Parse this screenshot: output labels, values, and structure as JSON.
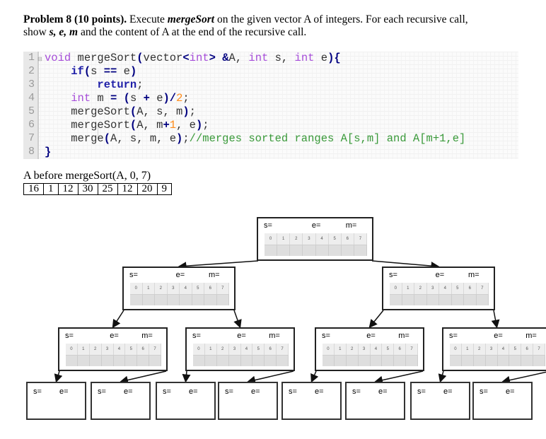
{
  "problem": {
    "heading": "Problem 8 (10 points).",
    "text1": " Execute ",
    "func": "mergeSort",
    "text2": " on the given vector A of integers. For each recursive call,",
    "line2_pre": "show ",
    "vars": "s, e, m",
    "line2_post": " and the content of A at the end of the recursive call."
  },
  "code": {
    "line_numbers": [
      "1",
      "2",
      "3",
      "4",
      "5",
      "6",
      "7",
      "8"
    ],
    "lines": [
      "void mergeSort(vector<int> &A, int s, int e){",
      "    if(s == e)",
      "        return;",
      "    int m = (s + e)/2;",
      "    mergeSort(A, s, m);",
      "    mergeSort(A, m+1, e);",
      "    merge(A, s, m, e);//merges sorted ranges A[s,m] and A[m+1,e]",
      "}"
    ]
  },
  "initial_array": {
    "label": "A  before mergeSort(A, 0, 7)",
    "values": [
      "16",
      "1",
      "12",
      "30",
      "25",
      "12",
      "20",
      "9"
    ]
  },
  "tree": {
    "node_labels": {
      "s": "s=",
      "e": "e=",
      "m": "m="
    },
    "index_headers": [
      "0",
      "1",
      "2",
      "3",
      "4",
      "5",
      "6",
      "7"
    ],
    "levels": [
      {
        "level": 0,
        "nodes": 1,
        "type": "full"
      },
      {
        "level": 1,
        "nodes": 2,
        "type": "full"
      },
      {
        "level": 2,
        "nodes": 4,
        "type": "full"
      },
      {
        "level": 3,
        "nodes": 8,
        "type": "leaf"
      }
    ]
  }
}
